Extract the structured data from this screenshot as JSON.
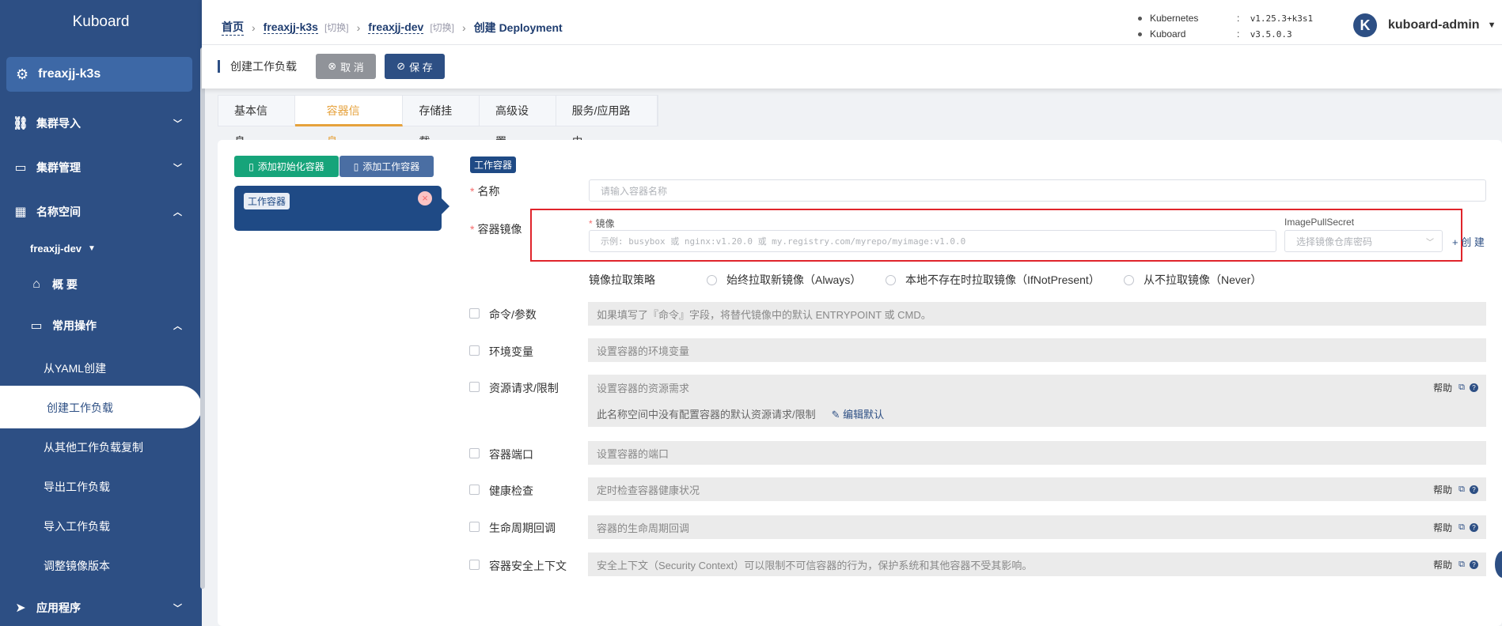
{
  "sidebar": {
    "title": "Kuboard",
    "cluster": "freaxjj-k3s",
    "items": [
      {
        "label": "集群导入"
      },
      {
        "label": "集群管理"
      },
      {
        "label": "名称空间"
      },
      {
        "label": "freaxjj-dev"
      },
      {
        "label": "概 要"
      },
      {
        "label": "常用操作"
      },
      {
        "label": "从YAML创建"
      },
      {
        "label": "创建工作负载"
      },
      {
        "label": "从其他工作负载复制"
      },
      {
        "label": "导出工作负载"
      },
      {
        "label": "导入工作负载"
      },
      {
        "label": "调整镜像版本"
      },
      {
        "label": "应用程序"
      }
    ]
  },
  "breadcrumb": {
    "home": "首页",
    "cluster": "freaxjj-k3s",
    "switch": "[切换]",
    "namespace": "freaxjj-dev",
    "current": "创建 Deployment"
  },
  "versions": [
    {
      "name": "Kubernetes",
      "sep": ":",
      "value": "v1.25.3+k3s1"
    },
    {
      "name": "Kuboard",
      "sep": ":",
      "value": "v3.5.0.3"
    }
  ],
  "user": {
    "avatar": "K",
    "name": "kuboard-admin"
  },
  "toolbar": {
    "title": "创建工作负载",
    "cancel": "取 消",
    "save": "保 存"
  },
  "tabs": [
    "基本信息",
    "容器信息",
    "存储挂载",
    "高级设置",
    "服务/应用路由"
  ],
  "left": {
    "add_init": "添加初始化容器",
    "add_work": "添加工作容器",
    "container_tag": "工作容器",
    "remove": "×"
  },
  "form": {
    "section_tag": "工作容器",
    "name_label": "名称",
    "name_placeholder": "请输入容器名称",
    "image_label": "容器镜像",
    "image_sub_label": "镜像",
    "image_placeholder": "示例: busybox 或 nginx:v1.20.0 或 my.registry.com/myrepo/myimage:v1.0.0",
    "secret_label": "ImagePullSecret",
    "secret_placeholder": "选择镜像仓库密码",
    "create": "+ 创 建",
    "pull_policy_label": "镜像拉取策略",
    "pull_options": [
      "始终拉取新镜像（Always）",
      "本地不存在时拉取镜像（IfNotPresent）",
      "从不拉取镜像（Never）"
    ],
    "help_label": "帮助",
    "rows": [
      {
        "label": "命令/参数",
        "text": "如果填写了『命令』字段，将替代镜像中的默认 ENTRYPOINT 或 CMD。"
      },
      {
        "label": "环境变量",
        "text": "设置容器的环境变量"
      },
      {
        "label": "资源请求/限制",
        "text": "设置容器的资源需求",
        "note": "此名称空间中没有配置容器的默认资源请求/限制",
        "edit": "编辑默认"
      },
      {
        "label": "容器端口",
        "text": "设置容器的端口"
      },
      {
        "label": "健康检查",
        "text": "定时检查容器健康状况"
      },
      {
        "label": "生命周期回调",
        "text": "容器的生命周期回调"
      },
      {
        "label": "容器安全上下文",
        "text": "安全上下文（Security Context）可以限制不可信容器的行为，保护系统和其他容器不受其影响。"
      }
    ]
  }
}
